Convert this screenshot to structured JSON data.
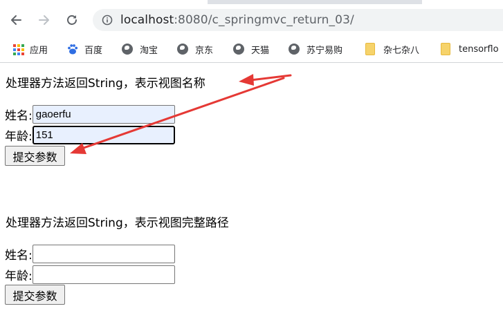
{
  "browser": {
    "url_host": "localhost",
    "url_path": ":8080/c_springmvc_return_03/",
    "bookmarks": [
      {
        "label": "应用",
        "icon": "apps-grid-icon"
      },
      {
        "label": "百度",
        "icon": "baidu-paw-icon"
      },
      {
        "label": "淘宝",
        "icon": "globe-icon"
      },
      {
        "label": "京东",
        "icon": "globe-icon"
      },
      {
        "label": "天猫",
        "icon": "globe-icon"
      },
      {
        "label": "苏宁易购",
        "icon": "globe-icon"
      },
      {
        "label": "杂七杂八",
        "icon": "folder-icon"
      },
      {
        "label": "tensorflo",
        "icon": "folder-icon"
      }
    ]
  },
  "form1": {
    "heading": "处理器方法返回String，表示视图名称",
    "name_label": "姓名:",
    "name_value": "gaoerfu",
    "age_label": "年龄:",
    "age_value": "151",
    "submit_label": "提交参数"
  },
  "form2": {
    "heading": "处理器方法返回String，表示视图完整路径",
    "name_label": "姓名:",
    "name_value": "",
    "age_label": "年龄:",
    "age_value": "",
    "submit_label": "提交参数"
  },
  "colors": {
    "annotation_arrow": "#e53935",
    "autofill_bg": "#e8f0fe",
    "omnibox_bg": "#f1f3f4"
  }
}
